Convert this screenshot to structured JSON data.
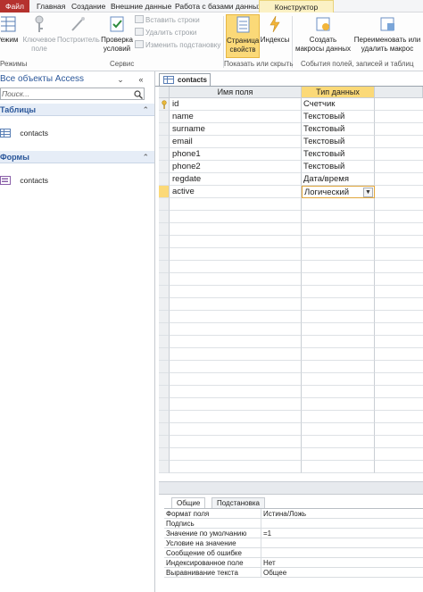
{
  "ribbon_tabs": {
    "file": "Файл",
    "home": "Главная",
    "create": "Создание",
    "external": "Внешние данные",
    "db_tools": "Работа с базами данных",
    "designer": "Конструктор"
  },
  "ribbon": {
    "mode_label": "Режим",
    "key_field": "Ключевое поле",
    "builder": "Построитель",
    "check_conditions": "Проверка условий",
    "insert_rows": "Вставить строки",
    "delete_rows": "Удалить строки",
    "modify_lookup": "Изменить подстановку",
    "property_sheet": "Страница свойств",
    "indexes": "Индексы",
    "create_macros": "Создать макросы данных",
    "rename_macro": "Переименовать или удалить макрос",
    "group_modes": "Режимы",
    "group_service": "Сервис",
    "group_show_hide": "Показать или скрыть",
    "group_events": "События полей, записей и таблиц"
  },
  "nav": {
    "title": "Все объекты Access",
    "search_placeholder": "Поиск...",
    "section_tables": "Таблицы",
    "section_forms": "Формы",
    "table_item": "contacts",
    "form_item": "contacts"
  },
  "document": {
    "tab_name": "contacts"
  },
  "grid": {
    "col_name": "Имя поля",
    "col_type": "Тип данных",
    "rows": [
      {
        "name": "id",
        "type": "Счетчик"
      },
      {
        "name": "name",
        "type": "Текстовый"
      },
      {
        "name": "surname",
        "type": "Текстовый"
      },
      {
        "name": "email",
        "type": "Текстовый"
      },
      {
        "name": "phone1",
        "type": "Текстовый"
      },
      {
        "name": "phone2",
        "type": "Текстовый"
      },
      {
        "name": "regdate",
        "type": "Дата/время"
      },
      {
        "name": "active",
        "type": "Логический"
      }
    ]
  },
  "properties": {
    "tab_general": "Общие",
    "tab_lookup": "Подстановка",
    "rows": [
      {
        "name": "Формат поля",
        "value": "Истина/Ложь"
      },
      {
        "name": "Подпись",
        "value": ""
      },
      {
        "name": "Значение по умолчанию",
        "value": "=1"
      },
      {
        "name": "Условие на значение",
        "value": ""
      },
      {
        "name": "Сообщение об ошибке",
        "value": ""
      },
      {
        "name": "Индексированное поле",
        "value": "Нет"
      },
      {
        "name": "Выравнивание текста",
        "value": "Общее"
      }
    ]
  },
  "colors": {
    "accent": "#fbd978",
    "file_tab": "#b5322e",
    "nav_text": "#2b579a"
  }
}
